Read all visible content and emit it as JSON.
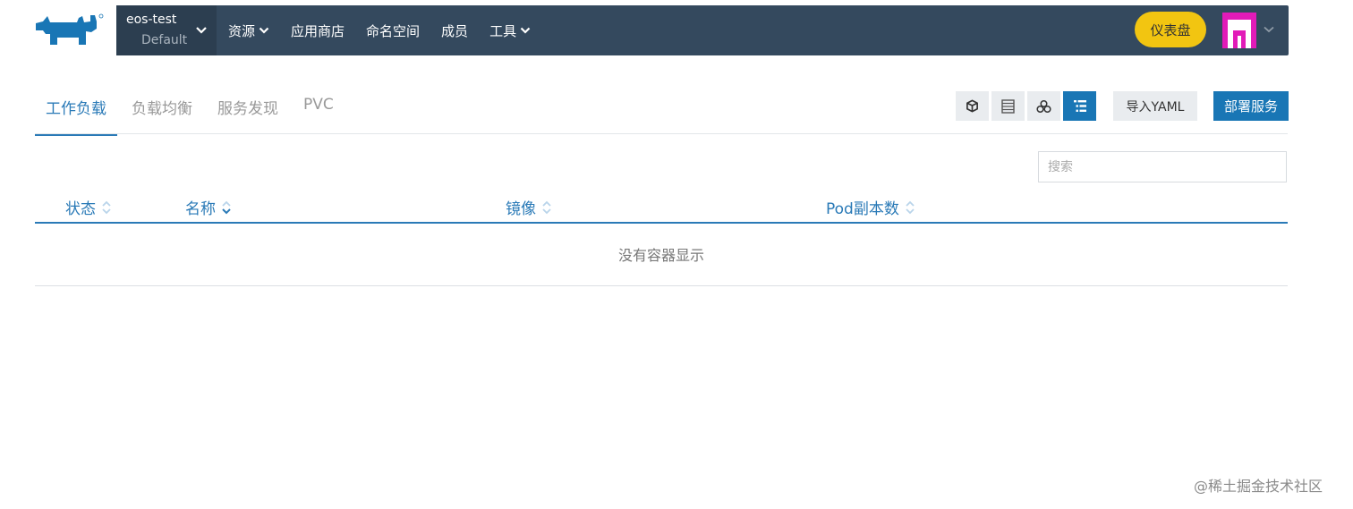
{
  "brand": {
    "logo_icon": "rancher-cow-logo-icon",
    "color": "#1976b5"
  },
  "header": {
    "project_name": "eos-test",
    "project_cluster": "Default",
    "nav": [
      {
        "label": "资源",
        "dropdown": true
      },
      {
        "label": "应用商店",
        "dropdown": false
      },
      {
        "label": "命名空间",
        "dropdown": false
      },
      {
        "label": "成员",
        "dropdown": false
      },
      {
        "label": "工具",
        "dropdown": true
      }
    ],
    "dashboard_label": "仪表盘",
    "bg": "#34495e",
    "accent": "#f2c511"
  },
  "tabs": [
    {
      "label": "工作负载",
      "active": true
    },
    {
      "label": "负载均衡",
      "active": false
    },
    {
      "label": "服务发现",
      "active": false
    },
    {
      "label": "PVC",
      "active": false
    }
  ],
  "toolbar": {
    "view_icons": [
      "cube-icon",
      "list-rows-icon",
      "cluster-icon",
      "tree-list-icon"
    ],
    "active_view": "tree-list-icon",
    "import_label": "导入YAML",
    "deploy_label": "部署服务"
  },
  "search": {
    "placeholder": "搜索",
    "value": ""
  },
  "table": {
    "columns": [
      {
        "label": "状态",
        "sort": "none"
      },
      {
        "label": "名称",
        "sort": "desc"
      },
      {
        "label": "镜像",
        "sort": "none"
      },
      {
        "label": "Pod副本数",
        "sort": "none"
      }
    ],
    "empty_message": "没有容器显示"
  },
  "watermark": "@稀土掘金技术社区"
}
